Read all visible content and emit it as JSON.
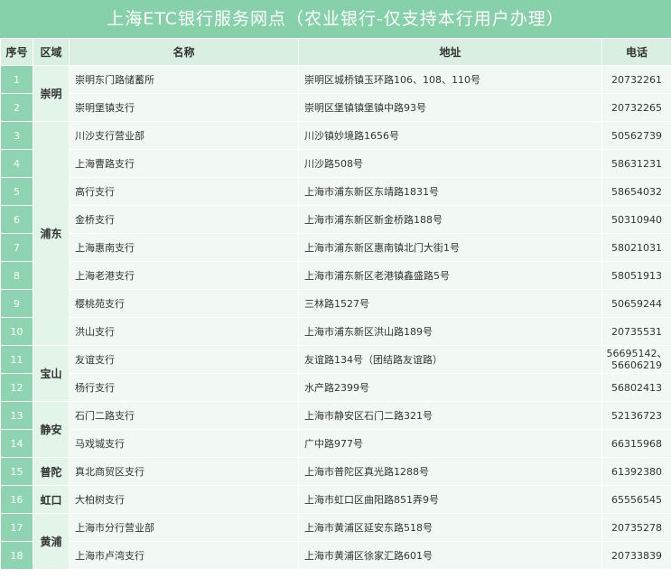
{
  "title": "上海ETC银行服务网点（农业银行-仅支持本行用户办理）",
  "headers": {
    "seq": "序号",
    "area": "区域",
    "name": "名称",
    "addr": "地址",
    "tel": "电话"
  },
  "rows": [
    {
      "seq": "1",
      "area": "崇明",
      "name": "崇明东门路储蓄所",
      "addr": "崇明区城桥镇玉环路106、108、110号",
      "tel": "20732261"
    },
    {
      "seq": "2",
      "name": "崇明堡镇支行",
      "addr": "崇明区堡镇镇堡镇中路93号",
      "tel": "20732265"
    },
    {
      "seq": "3",
      "area": "浦东",
      "name": "川沙支行营业部",
      "addr": "川沙镇妙境路1656号",
      "tel": "50562739"
    },
    {
      "seq": "4",
      "name": "上海曹路支行",
      "addr": "川沙路508号",
      "tel": "58631231"
    },
    {
      "seq": "5",
      "name": "高行支行",
      "addr": "上海市浦东新区东靖路1831号",
      "tel": "58654032"
    },
    {
      "seq": "6",
      "name": "金桥支行",
      "addr": "上海市浦东新区新金桥路188号",
      "tel": "50310940"
    },
    {
      "seq": "7",
      "name": "上海惠南支行",
      "addr": "上海市浦东新区惠南镇北门大街1号",
      "tel": "58021031"
    },
    {
      "seq": "8",
      "name": "上海老港支行",
      "addr": "上海市浦东新区老港镇鑫盛路5号",
      "tel": "58051913"
    },
    {
      "seq": "9",
      "name": "樱桃苑支行",
      "addr": "三林路1527号",
      "tel": "50659244"
    },
    {
      "seq": "10",
      "name": "洪山支行",
      "addr": "上海市浦东新区洪山路189号",
      "tel": "20735531"
    },
    {
      "seq": "11",
      "area": "宝山",
      "name": "友谊支行",
      "addr": "友谊路134号（团结路友谊路）",
      "tel": "56695142、",
      "tel2": "56606219"
    },
    {
      "seq": "12",
      "name": "杨行支行",
      "addr": "水产路2399号",
      "tel": "56802413"
    },
    {
      "seq": "13",
      "area": "静安",
      "name": "石门二路支行",
      "addr": "上海市静安区石门二路321号",
      "tel": "52136723"
    },
    {
      "seq": "14",
      "name": "马戏城支行",
      "addr": "广中路977号",
      "tel": "66315968"
    },
    {
      "seq": "15",
      "area": "普陀",
      "name": "真北商贸区支行",
      "addr": "上海市普陀区真光路1288号",
      "tel": "61392380"
    },
    {
      "seq": "16",
      "area": "虹口",
      "name": "大柏树支行",
      "addr": "上海市虹口区曲阳路851弄9号",
      "tel": "65556545"
    },
    {
      "seq": "17",
      "area": "黄浦",
      "name": "上海市分行营业部",
      "addr": "上海市黄浦区延安东路518号",
      "tel": "20735278"
    },
    {
      "seq": "18",
      "name": "上海市卢湾支行",
      "addr": "上海市黄浦区徐家汇路601号",
      "tel": "20733839"
    }
  ]
}
